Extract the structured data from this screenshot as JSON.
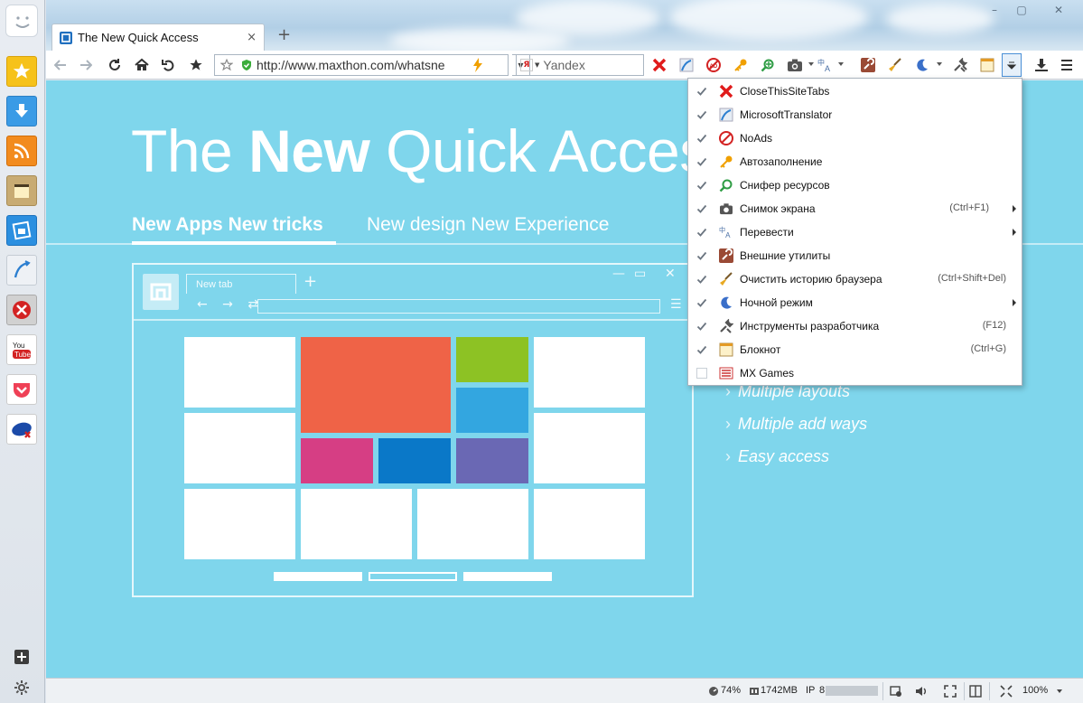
{
  "window": {
    "tab_title": "The New Quick Access",
    "tab_close": "×",
    "new_tab": "+",
    "min": "–",
    "max": "▢",
    "close": "✕"
  },
  "toolbar": {
    "url": "http://www.maxthon.com/whatsne",
    "search_engine": "Я",
    "search_placeholder": "Yandex",
    "back_icon": "arrow-left-icon",
    "forward_icon": "arrow-right-icon",
    "refresh_icon": "refresh-icon",
    "home_icon": "home-icon",
    "undo_icon": "undo-icon",
    "favorite_icon": "star-icon"
  },
  "content": {
    "hero_title_pre": "The ",
    "hero_title_bold": "New",
    "hero_title_post": " Quick Acces",
    "tab1": "New Apps New tricks",
    "tab2": "New design New Experience",
    "mock_tab": "New tab",
    "features": [
      "Multiple layouts",
      "Multiple add ways",
      "Easy access"
    ]
  },
  "menu": {
    "items": [
      {
        "label": "CloseThisSiteTabs",
        "shortcut": "",
        "checked": true,
        "submenu": false,
        "icon": "red-x-icon"
      },
      {
        "label": "MicrosoftTranslator",
        "shortcut": "",
        "checked": true,
        "submenu": false,
        "icon": "translator-icon"
      },
      {
        "label": "NoAds",
        "shortcut": "",
        "checked": true,
        "submenu": false,
        "icon": "noads-icon"
      },
      {
        "label": "Автозаполнение",
        "shortcut": "",
        "checked": true,
        "submenu": false,
        "icon": "key-icon"
      },
      {
        "label": "Снифер ресурсов",
        "shortcut": "",
        "checked": true,
        "submenu": false,
        "icon": "sniffer-icon"
      },
      {
        "label": "Снимок экрана",
        "shortcut": "(Ctrl+F1)",
        "checked": true,
        "submenu": true,
        "icon": "camera-icon"
      },
      {
        "label": "Перевести",
        "shortcut": "",
        "checked": true,
        "submenu": true,
        "icon": "translate-icon"
      },
      {
        "label": "Внешние утилиты",
        "shortcut": "",
        "checked": true,
        "submenu": false,
        "icon": "tools-box-icon"
      },
      {
        "label": "Очистить историю браузера",
        "shortcut": "(Ctrl+Shift+Del)",
        "checked": true,
        "submenu": false,
        "icon": "broom-icon"
      },
      {
        "label": "Ночной режим",
        "shortcut": "",
        "checked": true,
        "submenu": true,
        "icon": "moon-icon"
      },
      {
        "label": "Инструменты разработчика",
        "shortcut": "(F12)",
        "checked": true,
        "submenu": false,
        "icon": "wrench-icon"
      },
      {
        "label": "Блокнот",
        "shortcut": "(Ctrl+G)",
        "checked": true,
        "submenu": false,
        "icon": "notepad-icon"
      },
      {
        "label": "MX Games",
        "shortcut": "",
        "checked": false,
        "submenu": false,
        "icon": "games-icon"
      }
    ]
  },
  "status": {
    "cpu": "74%",
    "memory": "1742MB",
    "ip_label": "IP",
    "ip_value": "8",
    "zoom": "100%"
  },
  "colors": {
    "content_bg": "#7fd6ec",
    "tile_orange": "#ef6347",
    "tile_green": "#8dc224",
    "tile_blue": "#33a6e0",
    "tile_pink": "#d63e84",
    "tile_darkblue": "#0a78c8",
    "tile_purple": "#6a68b4"
  }
}
